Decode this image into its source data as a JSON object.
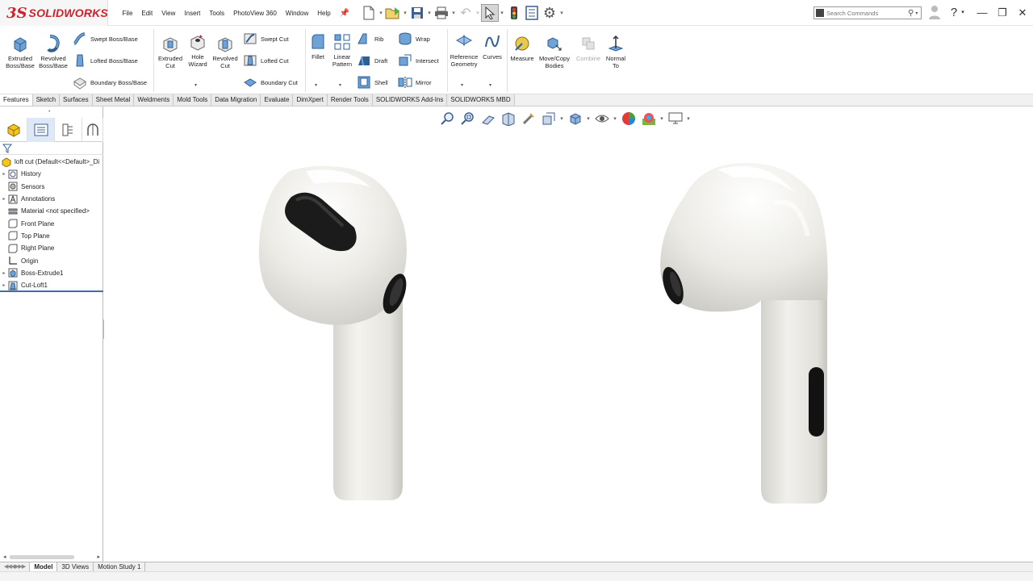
{
  "app": {
    "logo_ds": "3S",
    "logo_name": "SOLIDWORKS"
  },
  "menu": [
    "File",
    "Edit",
    "View",
    "Insert",
    "Tools",
    "PhotoView 360",
    "Window",
    "Help"
  ],
  "search": {
    "placeholder": "Search Commands"
  },
  "ribbon": {
    "extruded_boss": "Extruded Boss/Base",
    "revolved_boss": "Revolved Boss/Base",
    "swept_boss": "Swept Boss/Base",
    "lofted_boss": "Lofted Boss/Base",
    "boundary_boss": "Boundary Boss/Base",
    "extruded_cut": "Extruded Cut",
    "hole_wizard": "Hole Wizard",
    "revolved_cut": "Revolved Cut",
    "swept_cut": "Swept Cut",
    "lofted_cut": "Lofted Cut",
    "boundary_cut": "Boundary Cut",
    "fillet": "Fillet",
    "linear_pattern": "Linear Pattern",
    "rib": "Rib",
    "draft": "Draft",
    "shell": "Shell",
    "wrap": "Wrap",
    "intersect": "Intersect",
    "mirror": "Mirror",
    "reference_geometry": "Reference Geometry",
    "curves": "Curves",
    "measure": "Measure",
    "move_copy_bodies": "Move/Copy Bodies",
    "combine": "Combine",
    "normal_to": "Normal To"
  },
  "tabs": [
    "Features",
    "Sketch",
    "Surfaces",
    "Sheet Metal",
    "Weldments",
    "Mold Tools",
    "Data Migration",
    "Evaluate",
    "DimXpert",
    "Render Tools",
    "SOLIDWORKS Add-Ins",
    "SOLIDWORKS MBD"
  ],
  "active_tab": "Features",
  "tree": {
    "root": "loft cut  (Default<<Default>_Di",
    "items": [
      "History",
      "Sensors",
      "Annotations",
      "Material <not specified>",
      "Front Plane",
      "Top Plane",
      "Right Plane",
      "Origin",
      "Boss-Extrude1",
      "Cut-Loft1"
    ]
  },
  "bottom_tabs": [
    "Model",
    "3D Views",
    "Motion Study 1"
  ],
  "colors": {
    "brand": "#d0202c",
    "accent": "#3b6fb0",
    "body": "#ecebe6"
  }
}
